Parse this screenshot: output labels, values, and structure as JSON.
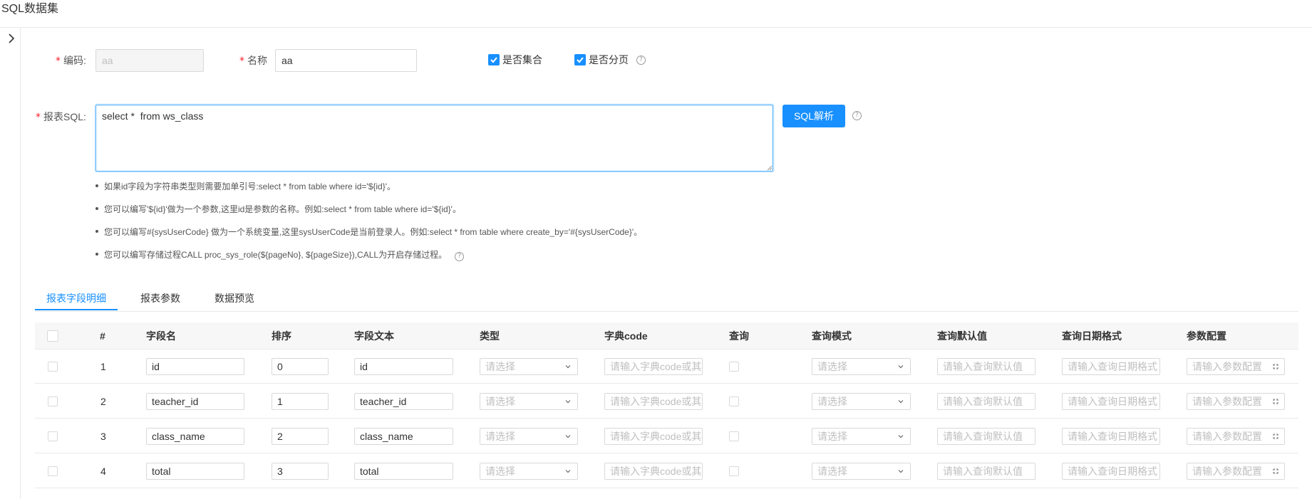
{
  "header": {
    "title": "SQL数据集"
  },
  "form": {
    "code": {
      "label": "编码:",
      "value": "aa"
    },
    "name": {
      "label": "名称",
      "value": "aa"
    },
    "is_collection": {
      "label": "是否集合",
      "checked": true
    },
    "is_paging": {
      "label": "是否分页",
      "checked": true
    },
    "help_glyph": "?",
    "sql": {
      "label": "报表SQL:",
      "value": "select *  from ws_class"
    },
    "parse_button": "SQL解析",
    "required_mark": "*"
  },
  "tips": [
    "如果id字段为字符串类型则需要加单引号:select * from table where id='${id}'。",
    "您可以编写'${id}'做为一个参数,这里id是参数的名称。例如:select * from table where id='${id}'。",
    "您可以编写#{sysUserCode} 做为一个系统变量,这里sysUserCode是当前登录人。例如:select * from table where create_by='#{sysUserCode}'。",
    "您可以编写存储过程CALL proc_sys_role(${pageNo}, ${pageSize}),CALL为开启存储过程。"
  ],
  "tabs": [
    {
      "label": "报表字段明细",
      "active": true
    },
    {
      "label": "报表参数",
      "active": false
    },
    {
      "label": "数据预览",
      "active": false
    }
  ],
  "table": {
    "columns": [
      "#",
      "字段名",
      "排序",
      "字段文本",
      "类型",
      "字典code",
      "查询",
      "查询模式",
      "查询默认值",
      "查询日期格式",
      "参数配置"
    ],
    "placeholders": {
      "type": "请选择",
      "dict_code": "请输入字典code或其",
      "query_mode": "请选择",
      "query_default": "请输入查询默认值",
      "date_format": "请输入查询日期格式",
      "param_config": "请输入参数配置"
    },
    "rows": [
      {
        "index": "1",
        "field_name": "id",
        "order": "0",
        "field_text": "id"
      },
      {
        "index": "2",
        "field_name": "teacher_id",
        "order": "1",
        "field_text": "teacher_id"
      },
      {
        "index": "3",
        "field_name": "class_name",
        "order": "2",
        "field_text": "class_name"
      },
      {
        "index": "4",
        "field_name": "total",
        "order": "3",
        "field_text": "total"
      }
    ]
  },
  "colors": {
    "primary": "#1890ff",
    "required": "#f5222d",
    "border": "#d9d9d9",
    "placeholder": "#bfbfbf"
  }
}
